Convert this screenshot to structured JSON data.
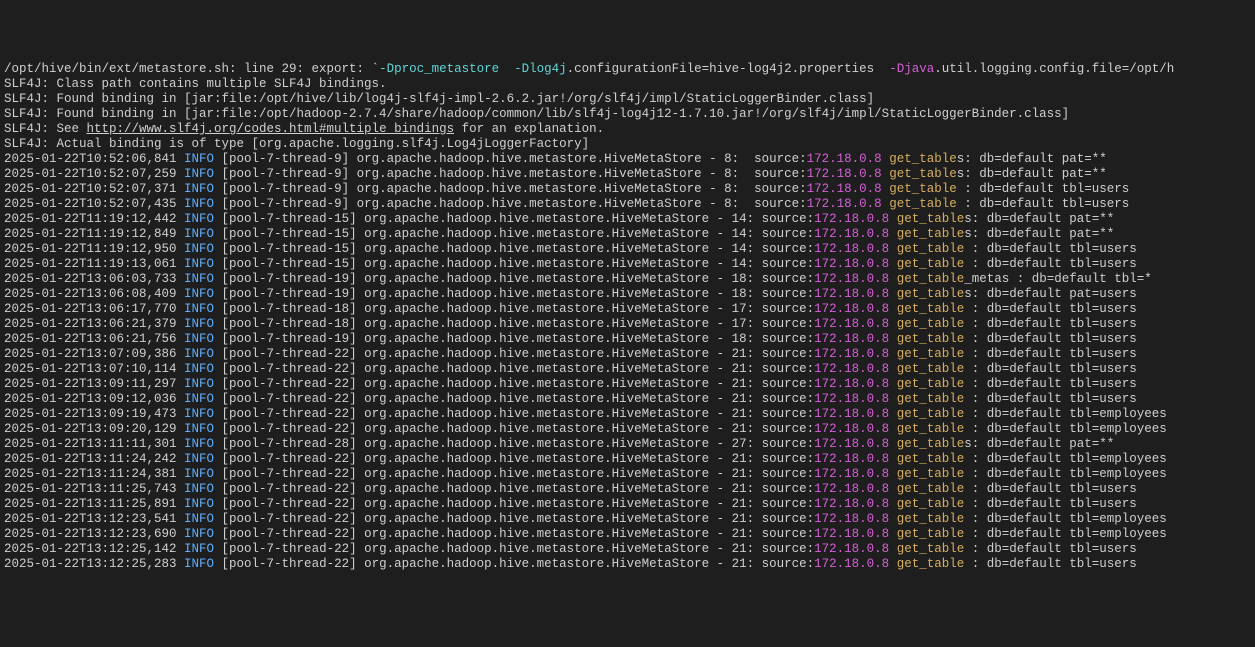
{
  "header": {
    "prefix": "/opt/hive/bin/ext/metastore.sh: line 29: export: `",
    "opt1": "-Dproc_metastore",
    "opt2": "-Dlog4j",
    "opt2_suffix": ".configurationFile=hive-log4j2.properties  ",
    "opt3": "-Djava",
    "opt3_suffix": ".util.logging.config.file=/opt/h",
    "l2": "SLF4J: Class path contains multiple SLF4J bindings.",
    "l3": "SLF4J: Found binding in [jar:file:/opt/hive/lib/log4j-slf4j-impl-2.6.2.jar!/org/slf4j/impl/StaticLoggerBinder.class]",
    "l4": "SLF4J: Found binding in [jar:file:/opt/hadoop-2.7.4/share/hadoop/common/lib/slf4j-log4j12-1.7.10.jar!/org/slf4j/impl/StaticLoggerBinder.class]",
    "l5a": "SLF4J: See ",
    "l5_link": "http://www.slf4j.org/codes.html#multiple_bindings",
    "l5b": " for an explanation.",
    "l6": "SLF4J: Actual binding is of type [org.apache.logging.slf4j.Log4jLoggerFactory]"
  },
  "lvl": "INFO",
  "ip": "172.18.0.8",
  "logs": [
    {
      "ts": "2025-01-22T10:52:06,841",
      "th": "[pool-7-thread-9] ",
      "cls": "org.apache.hadoop.hive.metastore.HiveMetaStore - 8: ",
      "src": " source:",
      "act": "get_table",
      "tail": "s: db=default pat=**"
    },
    {
      "ts": "2025-01-22T10:52:07,259",
      "th": "[pool-7-thread-9] ",
      "cls": "org.apache.hadoop.hive.metastore.HiveMetaStore - 8: ",
      "src": " source:",
      "act": "get_table",
      "tail": "s: db=default pat=**"
    },
    {
      "ts": "2025-01-22T10:52:07,371",
      "th": "[pool-7-thread-9] ",
      "cls": "org.apache.hadoop.hive.metastore.HiveMetaStore - 8: ",
      "src": " source:",
      "act": "get_table",
      "tail": " : db=default tbl=users"
    },
    {
      "ts": "2025-01-22T10:52:07,435",
      "th": "[pool-7-thread-9] ",
      "cls": "org.apache.hadoop.hive.metastore.HiveMetaStore - 8: ",
      "src": " source:",
      "act": "get_table",
      "tail": " : db=default tbl=users"
    },
    {
      "ts": "2025-01-22T11:19:12,442",
      "th": "[pool-7-thread-15]",
      "cls": " org.apache.hadoop.hive.metastore.HiveMetaStore - 14:",
      "src": " source:",
      "act": "get_table",
      "tail": "s: db=default pat=**"
    },
    {
      "ts": "2025-01-22T11:19:12,849",
      "th": "[pool-7-thread-15]",
      "cls": " org.apache.hadoop.hive.metastore.HiveMetaStore - 14:",
      "src": " source:",
      "act": "get_table",
      "tail": "s: db=default pat=**"
    },
    {
      "ts": "2025-01-22T11:19:12,950",
      "th": "[pool-7-thread-15]",
      "cls": " org.apache.hadoop.hive.metastore.HiveMetaStore - 14:",
      "src": " source:",
      "act": "get_table",
      "tail": " : db=default tbl=users"
    },
    {
      "ts": "2025-01-22T11:19:13,061",
      "th": "[pool-7-thread-15]",
      "cls": " org.apache.hadoop.hive.metastore.HiveMetaStore - 14:",
      "src": " source:",
      "act": "get_table",
      "tail": " : db=default tbl=users"
    },
    {
      "ts": "2025-01-22T13:06:03,733",
      "th": "[pool-7-thread-19]",
      "cls": " org.apache.hadoop.hive.metastore.HiveMetaStore - 18:",
      "src": " source:",
      "act": "get_table",
      "tail": "_metas : db=default tbl=*"
    },
    {
      "ts": "2025-01-22T13:06:08,409",
      "th": "[pool-7-thread-19]",
      "cls": " org.apache.hadoop.hive.metastore.HiveMetaStore - 18:",
      "src": " source:",
      "act": "get_table",
      "tail": "s: db=default pat=users"
    },
    {
      "ts": "2025-01-22T13:06:17,770",
      "th": "[pool-7-thread-18]",
      "cls": " org.apache.hadoop.hive.metastore.HiveMetaStore - 17:",
      "src": " source:",
      "act": "get_table",
      "tail": " : db=default tbl=users"
    },
    {
      "ts": "2025-01-22T13:06:21,379",
      "th": "[pool-7-thread-18]",
      "cls": " org.apache.hadoop.hive.metastore.HiveMetaStore - 17:",
      "src": " source:",
      "act": "get_table",
      "tail": " : db=default tbl=users"
    },
    {
      "ts": "2025-01-22T13:06:21,756",
      "th": "[pool-7-thread-19]",
      "cls": " org.apache.hadoop.hive.metastore.HiveMetaStore - 18:",
      "src": " source:",
      "act": "get_table",
      "tail": " : db=default tbl=users"
    },
    {
      "ts": "2025-01-22T13:07:09,386",
      "th": "[pool-7-thread-22]",
      "cls": " org.apache.hadoop.hive.metastore.HiveMetaStore - 21:",
      "src": " source:",
      "act": "get_table",
      "tail": " : db=default tbl=users"
    },
    {
      "ts": "2025-01-22T13:07:10,114",
      "th": "[pool-7-thread-22]",
      "cls": " org.apache.hadoop.hive.metastore.HiveMetaStore - 21:",
      "src": " source:",
      "act": "get_table",
      "tail": " : db=default tbl=users"
    },
    {
      "ts": "2025-01-22T13:09:11,297",
      "th": "[pool-7-thread-22]",
      "cls": " org.apache.hadoop.hive.metastore.HiveMetaStore - 21:",
      "src": " source:",
      "act": "get_table",
      "tail": " : db=default tbl=users"
    },
    {
      "ts": "2025-01-22T13:09:12,036",
      "th": "[pool-7-thread-22]",
      "cls": " org.apache.hadoop.hive.metastore.HiveMetaStore - 21:",
      "src": " source:",
      "act": "get_table",
      "tail": " : db=default tbl=users"
    },
    {
      "ts": "2025-01-22T13:09:19,473",
      "th": "[pool-7-thread-22]",
      "cls": " org.apache.hadoop.hive.metastore.HiveMetaStore - 21:",
      "src": " source:",
      "act": "get_table",
      "tail": " : db=default tbl=employees"
    },
    {
      "ts": "2025-01-22T13:09:20,129",
      "th": "[pool-7-thread-22]",
      "cls": " org.apache.hadoop.hive.metastore.HiveMetaStore - 21:",
      "src": " source:",
      "act": "get_table",
      "tail": " : db=default tbl=employees"
    },
    {
      "ts": "2025-01-22T13:11:11,301",
      "th": "[pool-7-thread-28]",
      "cls": " org.apache.hadoop.hive.metastore.HiveMetaStore - 27:",
      "src": " source:",
      "act": "get_table",
      "tail": "s: db=default pat=**"
    },
    {
      "ts": "2025-01-22T13:11:24,242",
      "th": "[pool-7-thread-22]",
      "cls": " org.apache.hadoop.hive.metastore.HiveMetaStore - 21:",
      "src": " source:",
      "act": "get_table",
      "tail": " : db=default tbl=employees"
    },
    {
      "ts": "2025-01-22T13:11:24,381",
      "th": "[pool-7-thread-22]",
      "cls": " org.apache.hadoop.hive.metastore.HiveMetaStore - 21:",
      "src": " source:",
      "act": "get_table",
      "tail": " : db=default tbl=employees"
    },
    {
      "ts": "2025-01-22T13:11:25,743",
      "th": "[pool-7-thread-22]",
      "cls": " org.apache.hadoop.hive.metastore.HiveMetaStore - 21:",
      "src": " source:",
      "act": "get_table",
      "tail": " : db=default tbl=users"
    },
    {
      "ts": "2025-01-22T13:11:25,891",
      "th": "[pool-7-thread-22]",
      "cls": " org.apache.hadoop.hive.metastore.HiveMetaStore - 21:",
      "src": " source:",
      "act": "get_table",
      "tail": " : db=default tbl=users"
    },
    {
      "ts": "2025-01-22T13:12:23,541",
      "th": "[pool-7-thread-22]",
      "cls": " org.apache.hadoop.hive.metastore.HiveMetaStore - 21:",
      "src": " source:",
      "act": "get_table",
      "tail": " : db=default tbl=employees"
    },
    {
      "ts": "2025-01-22T13:12:23,690",
      "th": "[pool-7-thread-22]",
      "cls": " org.apache.hadoop.hive.metastore.HiveMetaStore - 21:",
      "src": " source:",
      "act": "get_table",
      "tail": " : db=default tbl=employees"
    },
    {
      "ts": "2025-01-22T13:12:25,142",
      "th": "[pool-7-thread-22]",
      "cls": " org.apache.hadoop.hive.metastore.HiveMetaStore - 21:",
      "src": " source:",
      "act": "get_table",
      "tail": " : db=default tbl=users"
    },
    {
      "ts": "2025-01-22T13:12:25,283",
      "th": "[pool-7-thread-22]",
      "cls": " org.apache.hadoop.hive.metastore.HiveMetaStore - 21:",
      "src": " source:",
      "act": "get_table",
      "tail": " : db=default tbl=users"
    }
  ]
}
